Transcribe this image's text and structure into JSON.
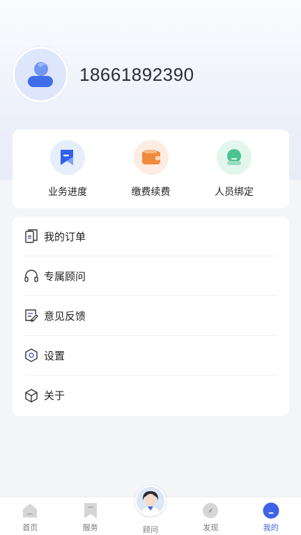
{
  "profile": {
    "phone": "18661892390",
    "avatar_icon": "user-avatar-icon"
  },
  "quick_actions": [
    {
      "label": "业务进度",
      "icon": "progress-flag-icon",
      "color": "#2f62f2",
      "bg": "#e6eefc"
    },
    {
      "label": "缴费续费",
      "icon": "wallet-icon",
      "color": "#f08a3c",
      "bg": "#fdece3"
    },
    {
      "label": "人员绑定",
      "icon": "person-bind-icon",
      "color": "#4cc48f",
      "bg": "#e3f6ee"
    }
  ],
  "menu": [
    {
      "label": "我的订单",
      "icon": "document-icon"
    },
    {
      "label": "专属顾问",
      "icon": "headset-icon"
    },
    {
      "label": "意见反馈",
      "icon": "feedback-edit-icon"
    },
    {
      "label": "设置",
      "icon": "settings-hexagon-icon"
    },
    {
      "label": "关于",
      "icon": "box-icon"
    }
  ],
  "tabbar": {
    "items": [
      {
        "label": "首页",
        "icon": "home-icon",
        "active": false
      },
      {
        "label": "服务",
        "icon": "bookmark-icon",
        "active": false
      },
      {
        "label": "顾问",
        "icon": "advisor-avatar-icon",
        "active": false
      },
      {
        "label": "发现",
        "icon": "compass-icon",
        "active": false
      },
      {
        "label": "我的",
        "icon": "me-icon",
        "active": true
      }
    ],
    "active_color": "#3d63e6",
    "inactive_color": "#777777"
  }
}
